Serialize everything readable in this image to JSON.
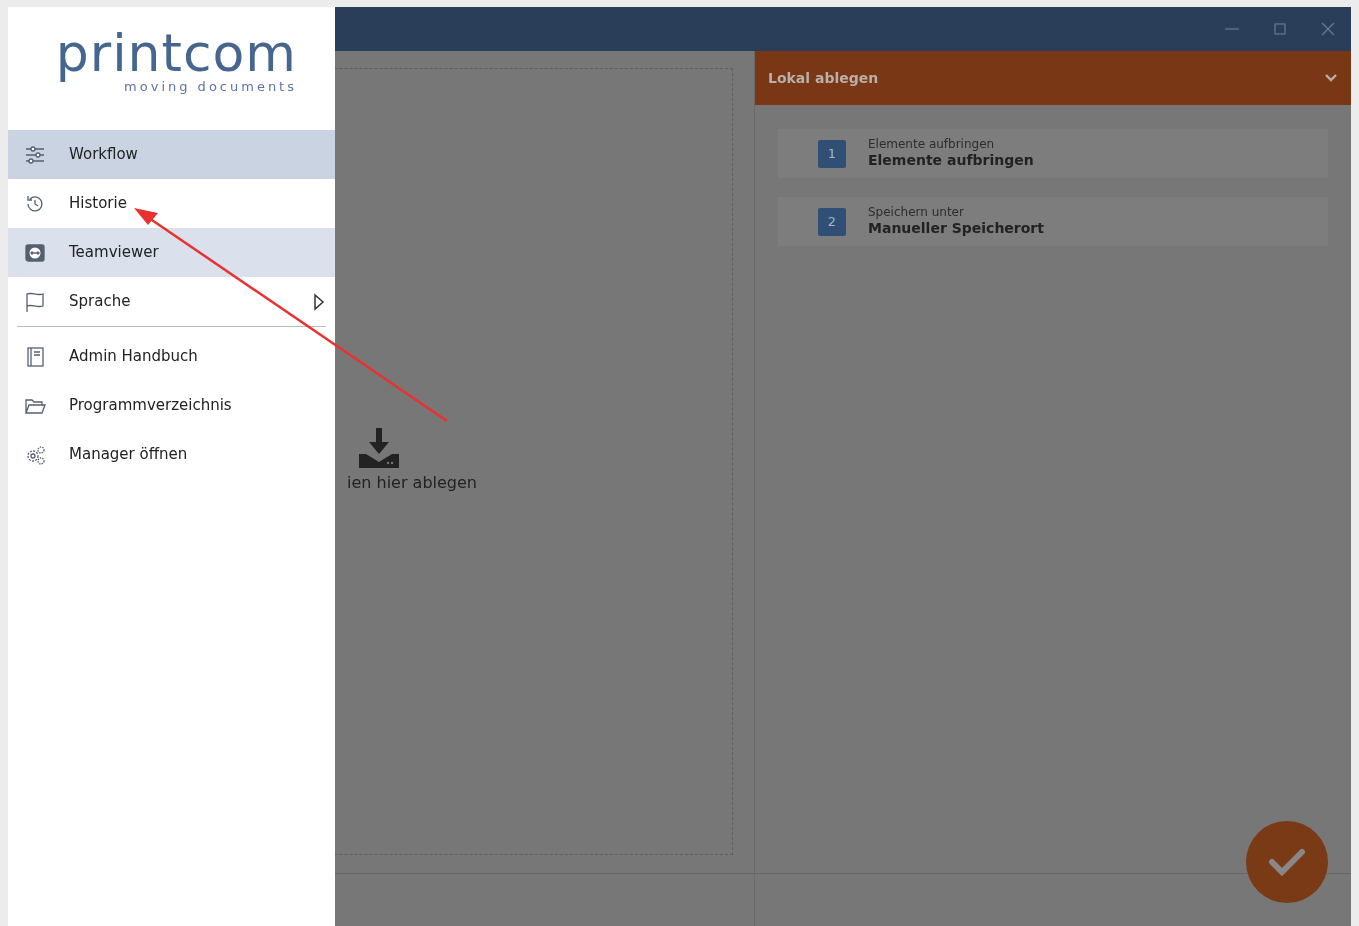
{
  "logo": {
    "name": "printcom",
    "tagline": "moving documents"
  },
  "menu_groups": [
    [
      {
        "label": "Workflow",
        "selected": true,
        "hovered": false,
        "submenu": false
      },
      {
        "label": "Historie",
        "selected": false,
        "hovered": false,
        "submenu": false
      },
      {
        "label": "Teamviewer",
        "selected": false,
        "hovered": true,
        "submenu": false
      },
      {
        "label": "Sprache",
        "selected": false,
        "hovered": false,
        "submenu": true
      }
    ],
    [
      {
        "label": "Admin Handbuch",
        "selected": false,
        "hovered": false,
        "submenu": false
      },
      {
        "label": "Programmverzeichnis",
        "selected": false,
        "hovered": false,
        "submenu": false
      },
      {
        "label": "Manager öffnen",
        "selected": false,
        "hovered": false,
        "submenu": false
      }
    ]
  ],
  "drop_zone": {
    "text": "ien hier ablegen"
  },
  "panel": {
    "title": "Lokal ablegen",
    "expanded": true,
    "steps": [
      {
        "number": "1",
        "caption": "Elemente aufbringen",
        "value": "Elemente aufbringen"
      },
      {
        "number": "2",
        "caption": "Speichern unter",
        "value": "Manueller Speicherort"
      }
    ]
  }
}
